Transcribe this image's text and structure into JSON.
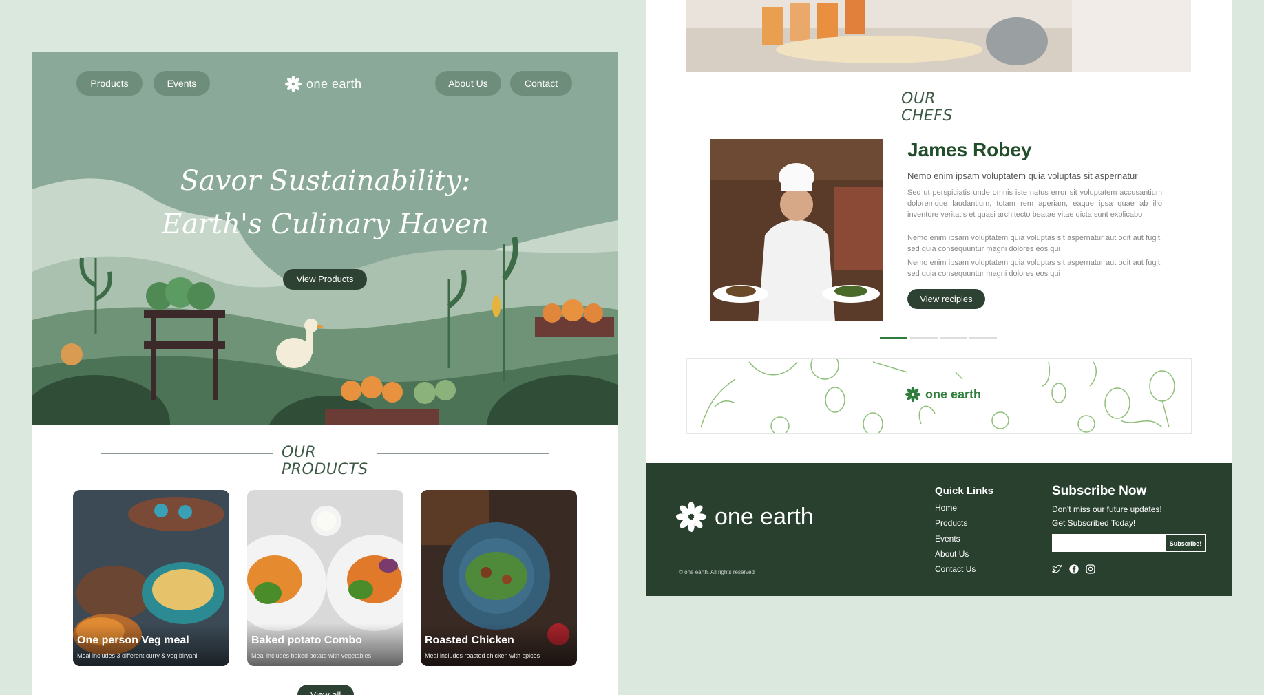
{
  "nav": {
    "products": "Products",
    "events": "Events",
    "about": "About Us",
    "contact": "Contact",
    "brand": "one earth"
  },
  "hero": {
    "title_line1": "Savor Sustainability:",
    "title_line2": "Earth's Culinary Haven",
    "cta": "View Products"
  },
  "products": {
    "heading": "OUR PRODUCTS",
    "items": [
      {
        "title": "One person Veg meal",
        "subtitle": "Meal includes 3 different curry & veg biryani"
      },
      {
        "title": "Baked potato Combo",
        "subtitle": "Meal includes baked potato with vegetables"
      },
      {
        "title": "Roasted Chicken",
        "subtitle": "Meal includes roasted chicken with spices"
      }
    ],
    "view_all": "View all"
  },
  "chefs": {
    "heading": "OUR CHEFS",
    "name": "James Robey",
    "subtitle": "Nemo enim ipsam voluptatem quia voluptas sit aspernatur",
    "para1": "Sed ut perspiciatis unde omnis iste natus error sit voluptatem accusantium doloremque laudantium, totam rem aperiam, eaque ipsa quae ab illo inventore veritatis et quasi architecto beatae vitae dicta sunt explicabo",
    "para2": "Nemo enim ipsam voluptatem quia voluptas sit aspernatur aut odit aut fugit, sed quia consequuntur magni dolores eos qui",
    "para3": "Nemo enim ipsam voluptatem quia voluptas sit aspernatur aut odit aut fugit, sed quia consequuntur magni dolores eos qui",
    "cta": "View recipies",
    "active_slide": 1,
    "slide_count": 4
  },
  "banner": {
    "brand": "one earth"
  },
  "footer": {
    "brand": "one earth",
    "copyright": "© one earth. All rights reserved",
    "quick_links_title": "Quick Links",
    "links": [
      "Home",
      "Products",
      "Events",
      "About Us",
      "Contact Us"
    ],
    "subscribe_title": "Subscribe Now",
    "subscribe_line1": "Don't miss our future updates!",
    "subscribe_line2": "Get Subscribed Today!",
    "subscribe_button": "Subscribe!",
    "email_placeholder": "",
    "social_icons": [
      "twitter-icon",
      "facebook-icon",
      "instagram-icon"
    ]
  },
  "colors": {
    "page_bg": "#dbe8de",
    "hero_bg": "#8aa998",
    "dark_green": "#29402f",
    "brand_green": "#214d2b",
    "accent_green": "#2e7d3a"
  }
}
